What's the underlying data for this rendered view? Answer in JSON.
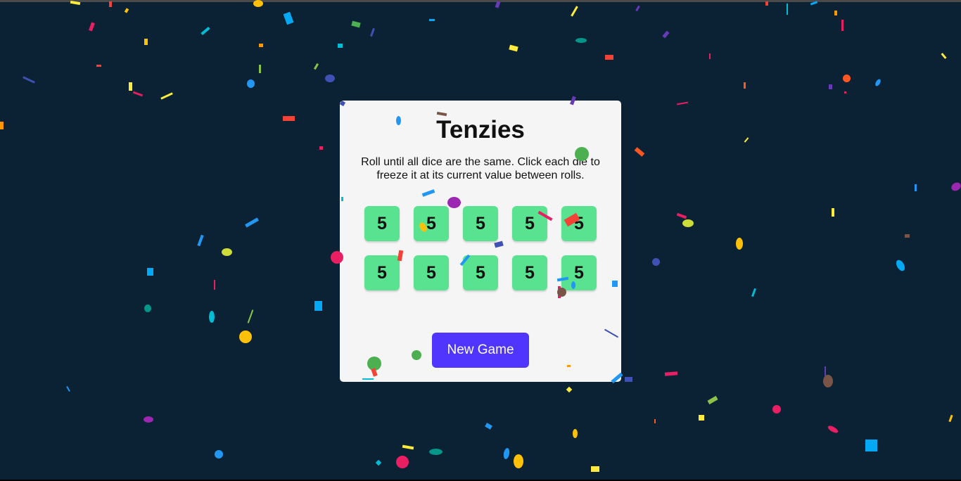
{
  "game": {
    "title": "Tenzies",
    "instructions": "Roll until all dice are the same. Click each die to freeze it at its current value between rolls.",
    "dice": [
      {
        "value": "5",
        "held": true
      },
      {
        "value": "5",
        "held": true
      },
      {
        "value": "5",
        "held": true
      },
      {
        "value": "5",
        "held": true
      },
      {
        "value": "5",
        "held": true
      },
      {
        "value": "5",
        "held": true
      },
      {
        "value": "5",
        "held": true
      },
      {
        "value": "5",
        "held": true
      },
      {
        "value": "5",
        "held": true
      },
      {
        "value": "5",
        "held": true
      }
    ],
    "new_game_label": "New Game",
    "won": true
  },
  "colors": {
    "background": "#0b2235",
    "card": "#f5f5f5",
    "die_held": "#59e391",
    "button": "#5035ff",
    "confetti": [
      "#f44336",
      "#e91e63",
      "#9c27b0",
      "#673ab7",
      "#3f51b5",
      "#2196f3",
      "#03a9f4",
      "#00bcd4",
      "#009688",
      "#4caf50",
      "#8bc34a",
      "#cddc39",
      "#ffeb3b",
      "#ffc107",
      "#ff9800",
      "#ff5722",
      "#795548"
    ]
  }
}
